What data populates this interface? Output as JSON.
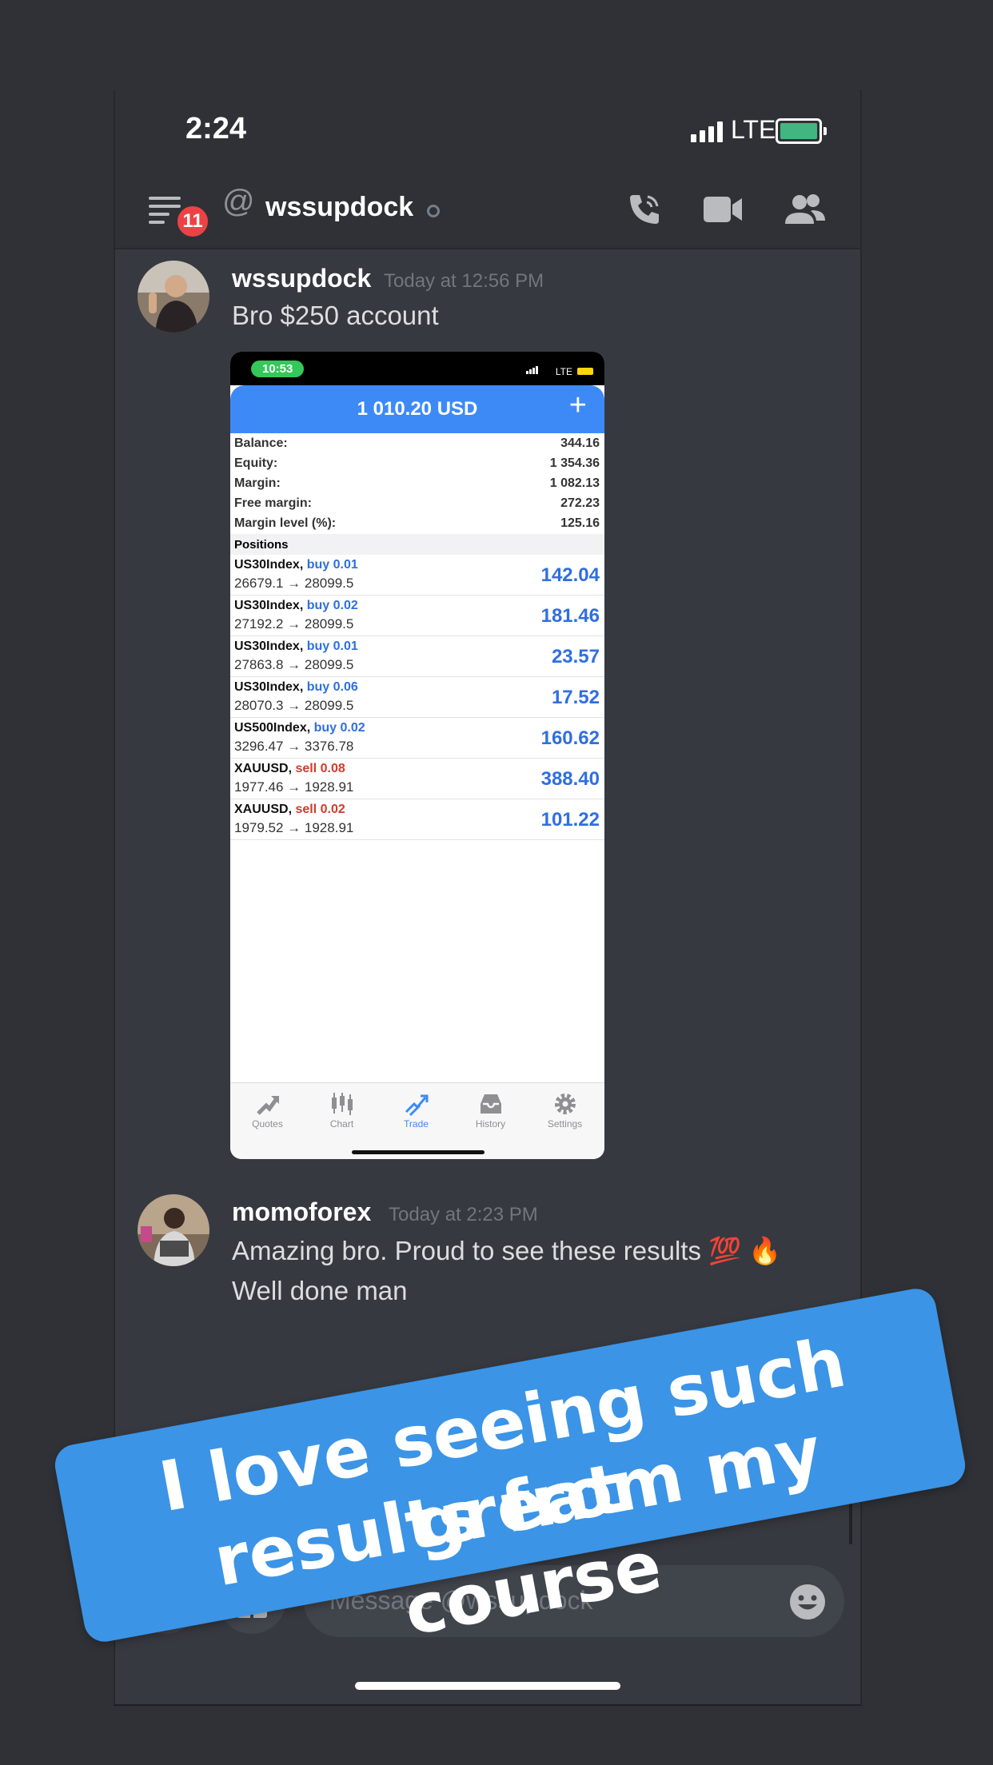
{
  "status_bar": {
    "time": "2:24",
    "network": "LTE"
  },
  "header": {
    "unread_badge": "11",
    "channel_name": "wssupdock",
    "icons": [
      "menu-icon",
      "at-icon",
      "call-icon",
      "video-icon",
      "members-icon"
    ]
  },
  "messages": [
    {
      "author": "wssupdock",
      "timestamp": "Today at 12:56 PM",
      "text": "Bro $250 account"
    },
    {
      "author": "momoforex",
      "timestamp": "Today at 2:23 PM",
      "text_line1": "Amazing bro. Proud to see these results 💯 🔥",
      "text_line2": "Well done man"
    }
  ],
  "attachment": {
    "status_time": "10:53",
    "status_network": "LTE",
    "balance_header": "1 010.20 USD",
    "account": [
      {
        "label": "Balance:",
        "value": "344.16"
      },
      {
        "label": "Equity:",
        "value": "1 354.36"
      },
      {
        "label": "Margin:",
        "value": "1 082.13"
      },
      {
        "label": "Free margin:",
        "value": "272.23"
      },
      {
        "label": "Margin level (%):",
        "value": "125.16"
      }
    ],
    "positions_title": "Positions",
    "positions": [
      {
        "symbol": "US30Index,",
        "side": "buy 0.01",
        "type": "buy",
        "prices": "26679.1 → 28099.5",
        "profit": "142.04"
      },
      {
        "symbol": "US30Index,",
        "side": "buy 0.02",
        "type": "buy",
        "prices": "27192.2 → 28099.5",
        "profit": "181.46"
      },
      {
        "symbol": "US30Index,",
        "side": "buy 0.01",
        "type": "buy",
        "prices": "27863.8 → 28099.5",
        "profit": "23.57"
      },
      {
        "symbol": "US30Index,",
        "side": "buy 0.06",
        "type": "buy",
        "prices": "28070.3 → 28099.5",
        "profit": "17.52"
      },
      {
        "symbol": "US500Index,",
        "side": "buy 0.02",
        "type": "buy",
        "prices": "3296.47 → 3376.78",
        "profit": "160.62"
      },
      {
        "symbol": "XAUUSD,",
        "side": "sell 0.08",
        "type": "sell",
        "prices": "1977.46 → 1928.91",
        "profit": "388.40"
      },
      {
        "symbol": "XAUUSD,",
        "side": "sell 0.02",
        "type": "sell",
        "prices": "1979.52 → 1928.91",
        "profit": "101.22"
      }
    ],
    "tabs": [
      "Quotes",
      "Chart",
      "Trade",
      "History",
      "Settings"
    ],
    "active_tab": "Trade"
  },
  "composer": {
    "placeholder": "Message @wssupdock"
  },
  "overlay": {
    "line1": "I love seeing such great",
    "line2": "results from my course"
  },
  "colors": {
    "background": "#36393f",
    "accent_blue": "#3d8af7",
    "banner": "#3b94e6",
    "badge_red": "#ed4245"
  }
}
